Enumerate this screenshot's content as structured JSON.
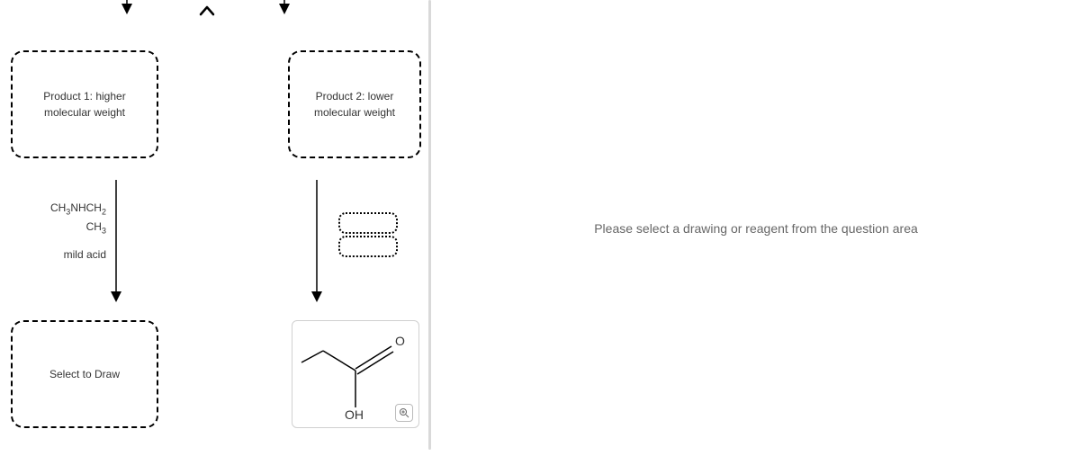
{
  "left": {
    "product1": {
      "line1": "Product 1: higher",
      "line2": "molecular weight"
    },
    "product2": {
      "line1": "Product 2: lower",
      "line2": "molecular weight"
    },
    "reagent": {
      "line1_prefix": "CH",
      "line1_sub1": "3",
      "line1_mid": "NHCH",
      "line1_sub2": "2",
      "line2_prefix": "CH",
      "line2_sub": "3",
      "condition": "mild acid"
    },
    "draw_box": "Select to Draw",
    "molecule": {
      "atom_O": "O",
      "atom_OH": "OH"
    }
  },
  "right": {
    "instruction": "Please select a drawing or reagent from the question area"
  }
}
